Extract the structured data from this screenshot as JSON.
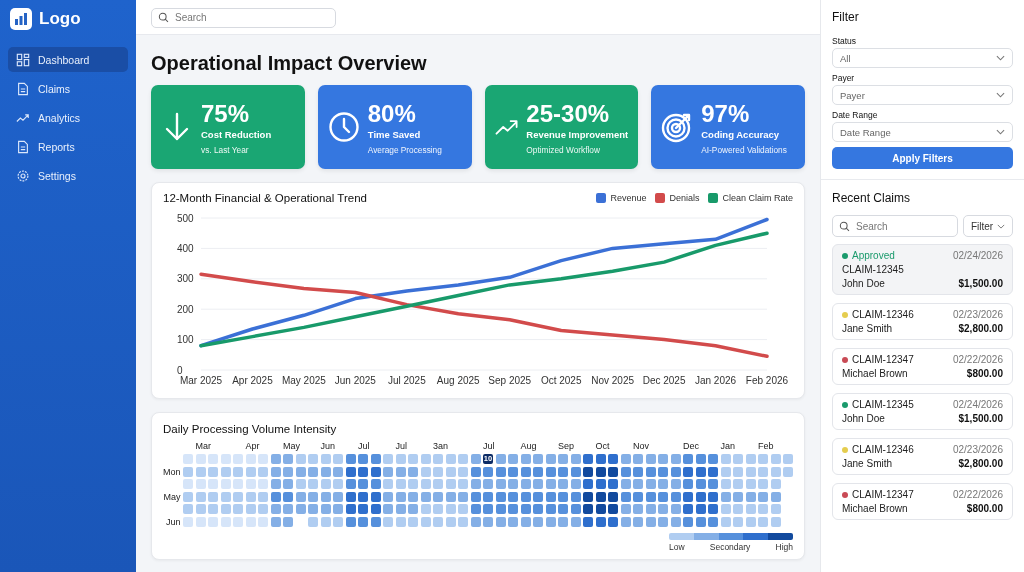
{
  "logo": {
    "text": "Logo"
  },
  "nav": [
    {
      "label": "Dashboard",
      "kind": "grid",
      "selected": true
    },
    {
      "label": "Claims",
      "kind": "doc",
      "selected": false
    },
    {
      "label": "Analytics",
      "kind": "trend",
      "selected": false
    },
    {
      "label": "Reports",
      "kind": "doc",
      "selected": false
    },
    {
      "label": "Settings",
      "kind": "gear",
      "selected": false
    }
  ],
  "search": {
    "placeholder": "Search"
  },
  "title": "Operational Impact Overview",
  "kpis": [
    {
      "value": "75%",
      "label": "Cost Reduction",
      "sub": "vs. Last Year",
      "kind": "arrow-down",
      "color": "#1aa673"
    },
    {
      "value": "80%",
      "label": "Time Saved",
      "sub": "Average Processing",
      "kind": "clock",
      "color": "#3577e0"
    },
    {
      "value": "25-30%",
      "label": "Revenue Improvement",
      "sub": "Optimized Workflow",
      "kind": "trend-up",
      "color": "#1aa673"
    },
    {
      "value": "97%",
      "label": "Coding Accuracy",
      "sub": "AI-Powered Validations",
      "kind": "target",
      "color": "#3577e0"
    }
  ],
  "trend": {
    "chart_data": {
      "type": "line",
      "title": "12-Month Financial & Operational Trend",
      "categories": [
        "Mar 2025",
        "Apr 2025",
        "May 2025",
        "Jun 2025",
        "Jul 2025",
        "Aug 2025",
        "Sep 2025",
        "Oct 2025",
        "Nov 2025",
        "Dec 2025",
        "Jan 2026",
        "Feb 2026"
      ],
      "ylim": [
        0,
        500
      ],
      "grid": true,
      "yticks": [
        0,
        100,
        200,
        300,
        400,
        500
      ],
      "series": [
        {
          "name": "Revenue",
          "color": "#3b70d6",
          "values": [
            80,
            135,
            180,
            235,
            260,
            280,
            305,
            360,
            400,
            415,
            430,
            495
          ]
        },
        {
          "name": "Denials",
          "color": "#d24b4b",
          "values": [
            315,
            290,
            268,
            255,
            215,
            185,
            165,
            130,
            115,
            100,
            80,
            45
          ]
        },
        {
          "name": "Clean Claim Rate",
          "color": "#189a6a",
          "values": [
            80,
            110,
            140,
            175,
            210,
            245,
            280,
            300,
            325,
            355,
            410,
            450
          ]
        }
      ]
    }
  },
  "heatmap": {
    "title": "Daily Processing Volume Intensity",
    "months": [
      "Mar",
      "Apr",
      "May",
      "Jun",
      "Jul",
      "Jul",
      "3an",
      "Jul",
      "Aug",
      "Sep",
      "Oct",
      "Nov",
      "Dec",
      "Jan",
      "Feb"
    ],
    "rows": [
      "Mon",
      "May",
      "Jun"
    ],
    "highlight": "10",
    "legend": [
      "Low",
      "Secondary",
      "High"
    ]
  },
  "filter": {
    "title": "Filter",
    "fields": [
      {
        "label": "Status",
        "value": "All"
      },
      {
        "label": "Payer",
        "value": "Payer"
      },
      {
        "label": "Date Range",
        "value": "Date Range"
      }
    ],
    "button": "Apply Filters"
  },
  "recent": {
    "title": "Recent Claims",
    "search_placeholder": "Search",
    "filter_button": "Filter",
    "claims": [
      {
        "status": "Approved",
        "id": "CLAIM-12345",
        "date": "02/24/2026",
        "name": "John Doe",
        "amount": "$1,500.00",
        "color": "#1a9a6c",
        "selected": true
      },
      {
        "id": "CLAIM-12346",
        "date": "02/23/2026",
        "name": "Jane Smith",
        "amount": "$2,800.00",
        "color": "#e5cd4f",
        "selected": false
      },
      {
        "id": "CLAIM-12347",
        "date": "02/22/2026",
        "name": "Michael Brown",
        "amount": "$800.00",
        "color": "#c94a55",
        "selected": false
      },
      {
        "id": "CLAIM-12345",
        "date": "02/24/2026",
        "name": "John Doe",
        "amount": "$1,500.00",
        "color": "#1a9a6c",
        "selected": false
      },
      {
        "id": "CLAIM-12346",
        "date": "02/23/2026",
        "name": "Jane Smith",
        "amount": "$2,800.00",
        "color": "#e5cd4f",
        "selected": false
      },
      {
        "id": "CLAIM-12347",
        "date": "02/22/2026",
        "name": "Michael Brown",
        "amount": "$800.00",
        "color": "#c94a55",
        "selected": false
      }
    ]
  }
}
